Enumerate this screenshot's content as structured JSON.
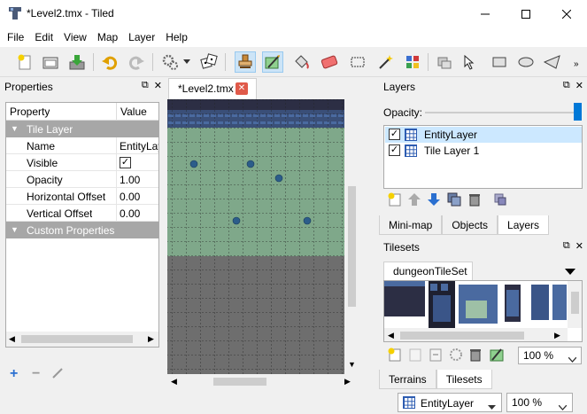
{
  "window": {
    "title": "*Level2.tmx - Tiled"
  },
  "menu": [
    "File",
    "Edit",
    "View",
    "Map",
    "Layer",
    "Help"
  ],
  "toolbar": {
    "icons": [
      "new-file-icon",
      "open-file-icon",
      "save-file-icon",
      "undo-icon",
      "redo-icon",
      "commands-icon",
      "random-mode-icon",
      "stamp-brush-icon",
      "terrain-brush-icon",
      "bucket-fill-icon",
      "eraser-icon",
      "rectangle-select-icon",
      "magic-wand-icon",
      "select-same-tile-icon",
      "select-objects-icon",
      "edit-polygons-icon",
      "insert-rectangle-icon",
      "insert-ellipse-icon",
      "insert-polygon-icon"
    ]
  },
  "properties": {
    "title": "Properties",
    "columns": [
      "Property",
      "Value"
    ],
    "group_tile_layer": "Tile Layer",
    "rows": [
      {
        "name": "Name",
        "value": "EntityLayer"
      },
      {
        "name": "Visible",
        "value": ""
      },
      {
        "name": "Opacity",
        "value": "1.00"
      },
      {
        "name": "Horizontal Offset",
        "value": "0.00"
      },
      {
        "name": "Vertical Offset",
        "value": "0.00"
      }
    ],
    "visible_checked": true,
    "group_custom": "Custom Properties"
  },
  "editor": {
    "tab_label": "*Level2.tmx"
  },
  "layers": {
    "title": "Layers",
    "opacity_label": "Opacity:",
    "opacity": 1.0,
    "items": [
      {
        "name": "EntityLayer",
        "visible": true,
        "selected": true
      },
      {
        "name": "Tile Layer 1",
        "visible": true,
        "selected": false
      }
    ],
    "tabs": [
      "Mini-map",
      "Objects",
      "Layers"
    ],
    "selected_tab": "Layers"
  },
  "tilesets": {
    "title": "Tilesets",
    "tab": "dungeonTileSet",
    "zoom": "100 %",
    "tabs": [
      "Terrains",
      "Tilesets"
    ],
    "selected_tab": "Tilesets"
  },
  "status": {
    "layer": "EntityLayer",
    "zoom": "100 %"
  },
  "colors": {
    "accent": "#0078d7",
    "group_bg": "#a7a7a7",
    "map_floor": "#7fa88a",
    "map_dark": "#6e6e6e"
  }
}
